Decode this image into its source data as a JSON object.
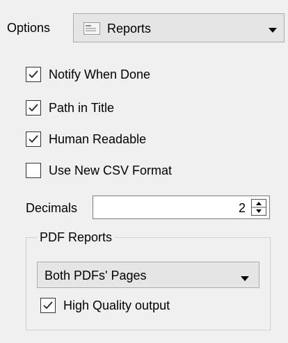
{
  "options": {
    "label": "Options",
    "selected": "Reports",
    "icon": "document-icon"
  },
  "checkboxes": [
    {
      "label": "Notify When Done",
      "checked": true
    },
    {
      "label": "Path in Title",
      "checked": true
    },
    {
      "label": "Human Readable",
      "checked": true
    },
    {
      "label": "Use New CSV Format",
      "checked": false
    }
  ],
  "decimals": {
    "label": "Decimals",
    "value": "2"
  },
  "pdf_reports": {
    "title": "PDF Reports",
    "selected": "Both PDFs' Pages",
    "high_quality_label": "High Quality output",
    "high_quality_checked": true
  }
}
